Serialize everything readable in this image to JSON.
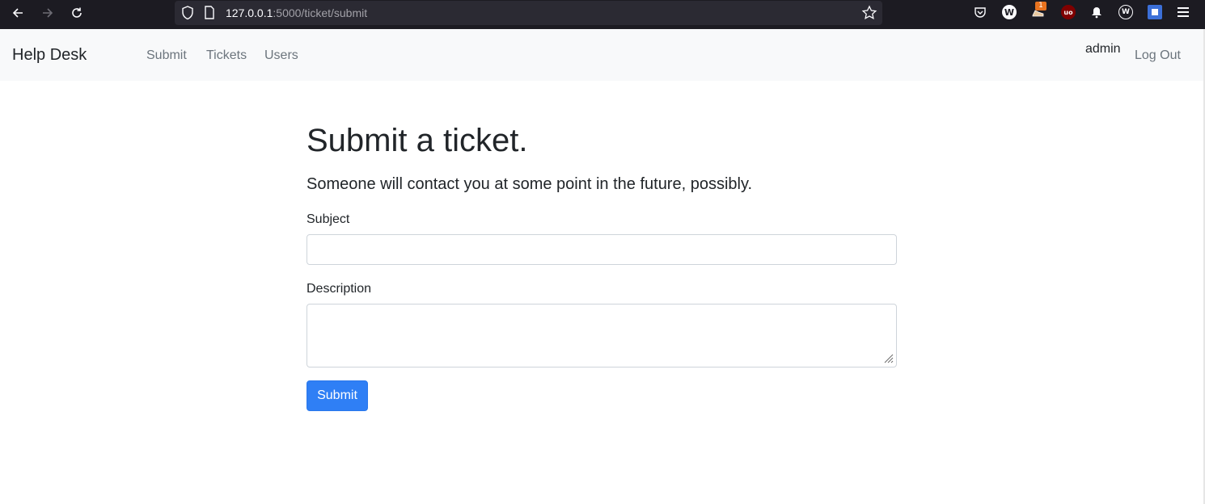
{
  "browser": {
    "url_host": "127.0.0.1",
    "url_path": ":5000/ticket/submit",
    "extension_badge": "1",
    "icons": [
      "back-arrow-icon",
      "forward-arrow-icon",
      "reload-icon",
      "shield-icon",
      "page-icon",
      "bookmark-star-icon",
      "pocket-icon",
      "w-extension-icon",
      "shoe-extension-icon",
      "ublock-icon",
      "alert-extension-icon",
      "w-circle-extension-icon",
      "shield-extension-icon",
      "hamburger-menu-icon"
    ]
  },
  "navbar": {
    "brand": "Help Desk",
    "links": [
      "Submit",
      "Tickets",
      "Users"
    ],
    "username": "admin",
    "logout": "Log Out"
  },
  "main": {
    "title": "Submit a ticket.",
    "lead": "Someone will contact you at some point in the future, possibly.",
    "subject_label": "Subject",
    "subject_value": "",
    "description_label": "Description",
    "description_value": "",
    "submit_label": "Submit"
  },
  "colors": {
    "primary_button": "#2f7ff5",
    "navbar_bg": "#f8f9fa",
    "browser_bg": "#1c1b22"
  }
}
